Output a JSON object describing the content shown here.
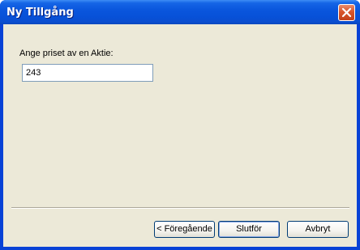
{
  "window": {
    "title": "Ny Tillgång",
    "close_icon": "close-icon"
  },
  "form": {
    "prompt_label": "Ange priset av en Aktie:",
    "price_value": "243"
  },
  "buttons": {
    "previous_label": "< Föregående",
    "finish_label": "Slutför",
    "cancel_label": "Avbryt"
  },
  "colors": {
    "titlebar": "#0a56dd",
    "dialog_background": "#ece9d8",
    "close_button": "#d8552b",
    "input_border": "#7f9db9"
  }
}
